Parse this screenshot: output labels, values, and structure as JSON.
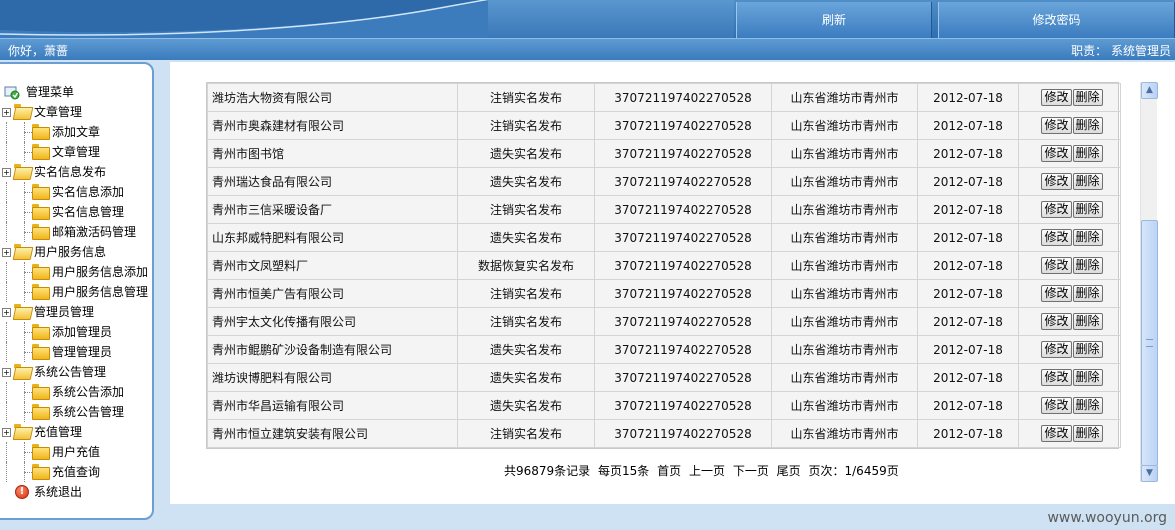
{
  "header": {
    "tabs": [
      {
        "label": "刷新"
      },
      {
        "label": "修改密码"
      }
    ],
    "greeting": "你好，萧蔷",
    "role": "职责： 系统管理员"
  },
  "sidebar": {
    "root": "管理菜单",
    "groups": [
      {
        "label": "文章管理",
        "children": [
          "添加文章",
          "文章管理"
        ]
      },
      {
        "label": "实名信息发布",
        "children": [
          "实名信息添加",
          "实名信息管理",
          "邮箱激活码管理"
        ]
      },
      {
        "label": "用户服务信息",
        "children": [
          "用户服务信息添加",
          "用户服务信息管理"
        ]
      },
      {
        "label": "管理员管理",
        "children": [
          "添加管理员",
          "管理管理员"
        ]
      },
      {
        "label": "系统公告管理",
        "children": [
          "系统公告添加",
          "系统公告管理"
        ]
      },
      {
        "label": "充值管理",
        "children": [
          "用户充值",
          "充值查询"
        ]
      }
    ],
    "exit": "系统退出"
  },
  "table": {
    "edit_label": "修改",
    "delete_label": "删除",
    "rows": [
      {
        "name": "潍坊浩大物资有限公司",
        "type": "注销实名发布",
        "id": "370721197402270528",
        "region": "山东省潍坊市青州市",
        "date": "2012-07-18"
      },
      {
        "name": "青州市奥森建材有限公司",
        "type": "注销实名发布",
        "id": "370721197402270528",
        "region": "山东省潍坊市青州市",
        "date": "2012-07-18"
      },
      {
        "name": "青州市图书馆",
        "type": "遗失实名发布",
        "id": "370721197402270528",
        "region": "山东省潍坊市青州市",
        "date": "2012-07-18"
      },
      {
        "name": "青州瑞达食品有限公司",
        "type": "遗失实名发布",
        "id": "370721197402270528",
        "region": "山东省潍坊市青州市",
        "date": "2012-07-18"
      },
      {
        "name": "青州市三信采暖设备厂",
        "type": "注销实名发布",
        "id": "370721197402270528",
        "region": "山东省潍坊市青州市",
        "date": "2012-07-18"
      },
      {
        "name": "山东邦威特肥料有限公司",
        "type": "遗失实名发布",
        "id": "370721197402270528",
        "region": "山东省潍坊市青州市",
        "date": "2012-07-18"
      },
      {
        "name": "青州市文凤塑料厂",
        "type": "数据恢复实名发布",
        "id": "370721197402270528",
        "region": "山东省潍坊市青州市",
        "date": "2012-07-18"
      },
      {
        "name": "青州市恒美广告有限公司",
        "type": "注销实名发布",
        "id": "370721197402270528",
        "region": "山东省潍坊市青州市",
        "date": "2012-07-18"
      },
      {
        "name": "青州宇太文化传播有限公司",
        "type": "注销实名发布",
        "id": "370721197402270528",
        "region": "山东省潍坊市青州市",
        "date": "2012-07-18"
      },
      {
        "name": "青州市鲲鹏矿沙设备制造有限公司",
        "type": "遗失实名发布",
        "id": "370721197402270528",
        "region": "山东省潍坊市青州市",
        "date": "2012-07-18"
      },
      {
        "name": "潍坊谀博肥料有限公司",
        "type": "遗失实名发布",
        "id": "370721197402270528",
        "region": "山东省潍坊市青州市",
        "date": "2012-07-18"
      },
      {
        "name": "青州市华昌运输有限公司",
        "type": "遗失实名发布",
        "id": "370721197402270528",
        "region": "山东省潍坊市青州市",
        "date": "2012-07-18"
      },
      {
        "name": "青州市恒立建筑安装有限公司",
        "type": "注销实名发布",
        "id": "370721197402270528",
        "region": "山东省潍坊市青州市",
        "date": "2012-07-18"
      }
    ]
  },
  "pager": {
    "total": "共96879条记录",
    "per_page": "每页15条",
    "first": "首页",
    "prev": "上一页",
    "next": "下一页",
    "last": "尾页",
    "page": "页次：1/6459页"
  },
  "icons": {
    "root": "menu-root-icon",
    "folder": "folder-icon",
    "exit": "exit-icon"
  },
  "colors": {
    "header_blue": "#3b7cc0",
    "sidebar_border": "#6b9fd4",
    "page_bg": "#cfe2f3",
    "table_bg": "#f4f4f4"
  },
  "watermark": "www.wooyun.org"
}
